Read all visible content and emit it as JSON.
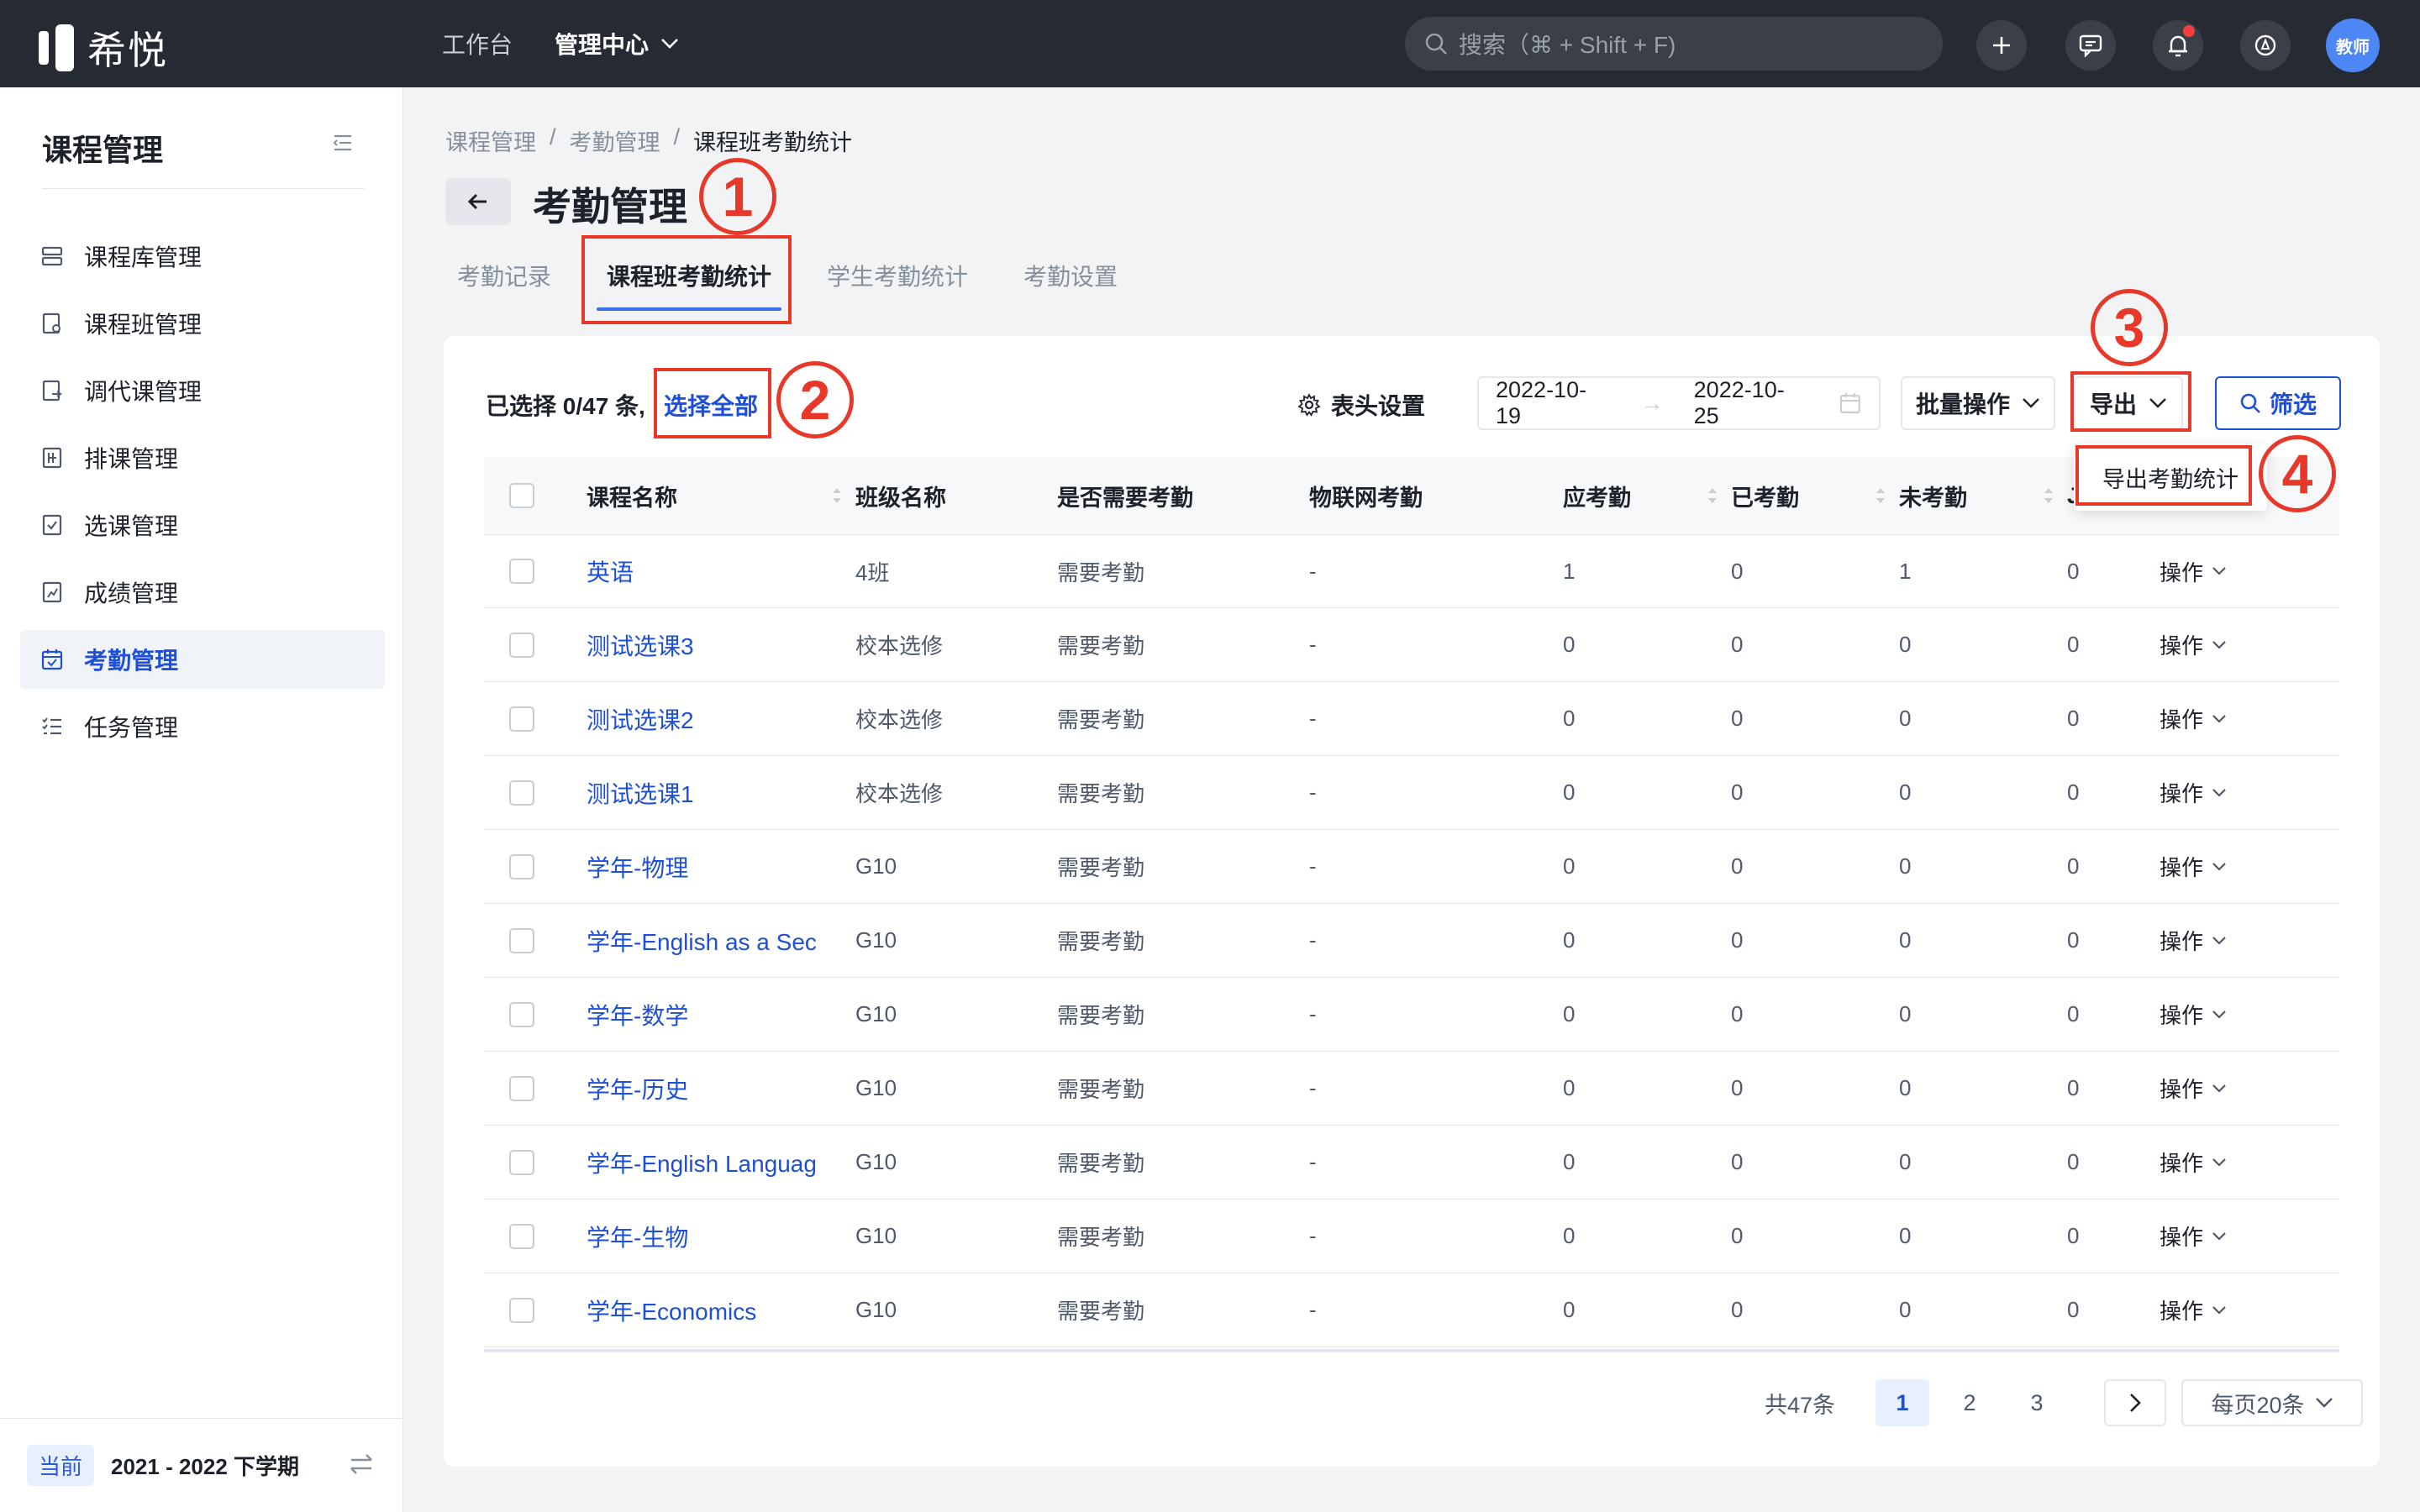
{
  "app": {
    "logo_text": "希悦"
  },
  "topnav": {
    "workbench": "工作台",
    "admin_center": "管理中心"
  },
  "search": {
    "placeholder": "搜索（⌘ + Shift + F)"
  },
  "user": {
    "avatar_text": "教师"
  },
  "sidebar": {
    "title": "课程管理",
    "items": [
      {
        "label": "课程库管理",
        "icon": "server-icon"
      },
      {
        "label": "课程班管理",
        "icon": "class-book-icon"
      },
      {
        "label": "调代课管理",
        "icon": "swap-doc-icon"
      },
      {
        "label": "排课管理",
        "icon": "schedule-icon"
      },
      {
        "label": "选课管理",
        "icon": "check-doc-icon"
      },
      {
        "label": "成绩管理",
        "icon": "chart-doc-icon"
      },
      {
        "label": "考勤管理",
        "icon": "calendar-check-icon",
        "active": true
      },
      {
        "label": "任务管理",
        "icon": "task-list-icon"
      }
    ],
    "term_tag": "当前",
    "term_text": "2021 - 2022 下学期"
  },
  "breadcrumb": {
    "level1": "课程管理",
    "level2": "考勤管理",
    "level3": "课程班考勤统计",
    "sep": "/"
  },
  "page": {
    "title": "考勤管理"
  },
  "tabs": [
    "考勤记录",
    "课程班考勤统计",
    "学生考勤统计",
    "考勤设置"
  ],
  "toolbar": {
    "selected_info": "已选择 0/47 条,",
    "select_all": "选择全部",
    "header_settings": "表头设置",
    "date_start": "2022-10-19",
    "date_arrow": "→",
    "date_end": "2022-10-25",
    "batch": "批量操作",
    "export": "导出",
    "filter": "筛选",
    "export_menu_item": "导出考勤统计"
  },
  "annotations": {
    "n1": "1",
    "n2": "2",
    "n3": "3",
    "n4": "4"
  },
  "table": {
    "headers": {
      "name": "课程名称",
      "class": "班级名称",
      "need": "是否需要考勤",
      "iot": "物联网考勤",
      "should": "应考勤",
      "done": "已考勤",
      "undone": "未考勤",
      "other": "J"
    },
    "op_label": "操作",
    "rows": [
      {
        "name": "英语",
        "class": "4班",
        "need": "需要考勤",
        "iot": "-",
        "should": "1",
        "done": "0",
        "undone": "1",
        "other": "0"
      },
      {
        "name": "测试选课3",
        "class": "校本选修",
        "need": "需要考勤",
        "iot": "-",
        "should": "0",
        "done": "0",
        "undone": "0",
        "other": "0"
      },
      {
        "name": "测试选课2",
        "class": "校本选修",
        "need": "需要考勤",
        "iot": "-",
        "should": "0",
        "done": "0",
        "undone": "0",
        "other": "0"
      },
      {
        "name": "测试选课1",
        "class": "校本选修",
        "need": "需要考勤",
        "iot": "-",
        "should": "0",
        "done": "0",
        "undone": "0",
        "other": "0"
      },
      {
        "name": "学年-物理",
        "class": "G10",
        "need": "需要考勤",
        "iot": "-",
        "should": "0",
        "done": "0",
        "undone": "0",
        "other": "0"
      },
      {
        "name": "学年-English as a Sec",
        "class": "G10",
        "need": "需要考勤",
        "iot": "-",
        "should": "0",
        "done": "0",
        "undone": "0",
        "other": "0"
      },
      {
        "name": "学年-数学",
        "class": "G10",
        "need": "需要考勤",
        "iot": "-",
        "should": "0",
        "done": "0",
        "undone": "0",
        "other": "0"
      },
      {
        "name": "学年-历史",
        "class": "G10",
        "need": "需要考勤",
        "iot": "-",
        "should": "0",
        "done": "0",
        "undone": "0",
        "other": "0"
      },
      {
        "name": "学年-English Languag",
        "class": "G10",
        "need": "需要考勤",
        "iot": "-",
        "should": "0",
        "done": "0",
        "undone": "0",
        "other": "0"
      },
      {
        "name": "学年-生物",
        "class": "G10",
        "need": "需要考勤",
        "iot": "-",
        "should": "0",
        "done": "0",
        "undone": "0",
        "other": "0"
      },
      {
        "name": "学年-Economics",
        "class": "G10",
        "need": "需要考勤",
        "iot": "-",
        "should": "0",
        "done": "0",
        "undone": "0",
        "other": "0"
      }
    ]
  },
  "pagination": {
    "total": "共47条",
    "pages": [
      "1",
      "2",
      "3"
    ],
    "current": "1",
    "page_size": "每页20条"
  },
  "colors": {
    "accent": "#1e4fd8",
    "annotation_red": "#e8382a",
    "topbar": "#252a33"
  }
}
